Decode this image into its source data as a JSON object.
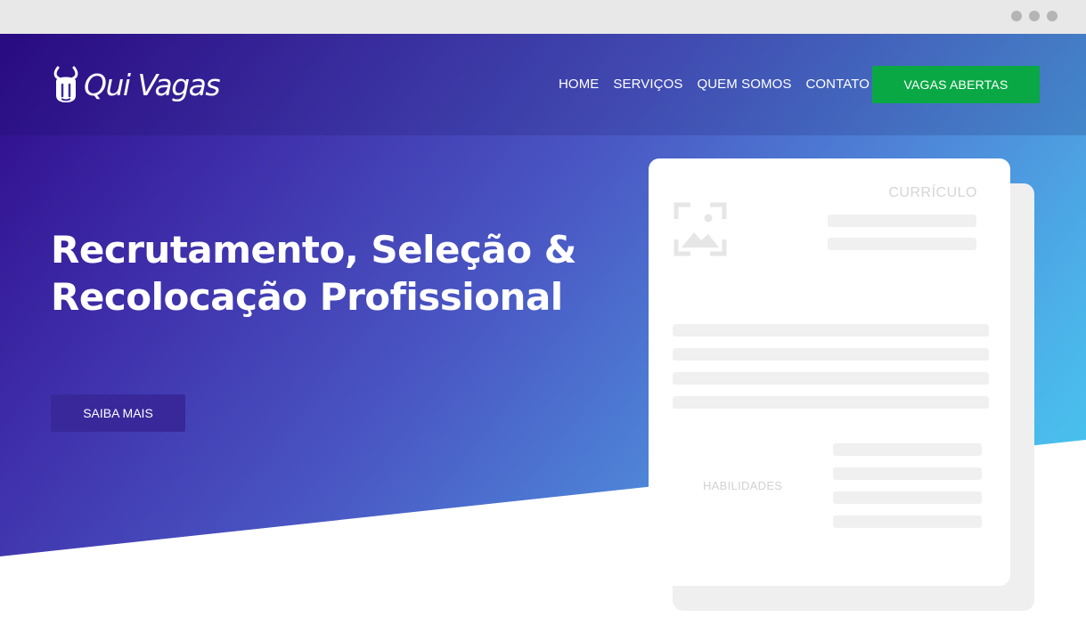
{
  "brand": {
    "name": "Qui Vagas",
    "colors": {
      "gradient_start": "#2e0a8a",
      "gradient_end": "#44d3f4",
      "cta_green": "#0aa845",
      "button_purple": "#38289a"
    }
  },
  "window_controls": [
    "dot",
    "dot",
    "dot"
  ],
  "nav": {
    "items": [
      "HOME",
      "SERVIÇOS",
      "QUEM SOMOS",
      "CONTATO"
    ],
    "cta_label": "VAGAS ABERTAS"
  },
  "hero": {
    "title": "Recrutamento, Seleção & Recolocação Profissional",
    "cta_label": "SAIBA MAIS"
  },
  "resume_card": {
    "title": "CURRÍCULO",
    "image_icon": "image-placeholder-icon",
    "skills_label": "HABILIDADES"
  }
}
